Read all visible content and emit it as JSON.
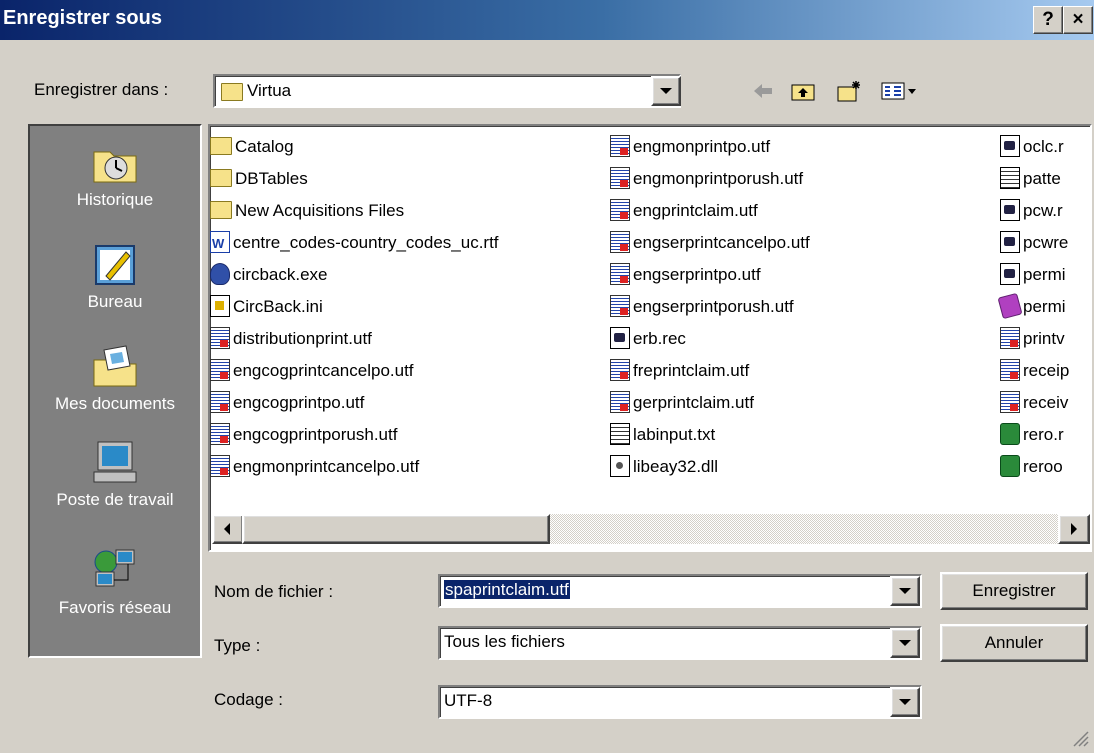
{
  "window": {
    "title": "Enregistrer sous",
    "help_label": "?",
    "close_label": "×"
  },
  "location": {
    "label": "Enregistrer dans :",
    "value": "Virtua"
  },
  "places": [
    {
      "label": "Historique",
      "icon": "history-icon"
    },
    {
      "label": "Bureau",
      "icon": "desktop-icon"
    },
    {
      "label": "Mes documents",
      "icon": "my-documents-icon"
    },
    {
      "label": "Poste de travail",
      "icon": "my-computer-icon"
    },
    {
      "label": "Favoris réseau",
      "icon": "network-icon"
    }
  ],
  "files": {
    "col1": [
      {
        "name": "Catalog",
        "type": "folder"
      },
      {
        "name": "DBTables",
        "type": "folder"
      },
      {
        "name": "New Acquisitions Files",
        "type": "folder"
      },
      {
        "name": "centre_codes-country_codes_uc.rtf",
        "type": "rtf"
      },
      {
        "name": "circback.exe",
        "type": "exe"
      },
      {
        "name": "CircBack.ini",
        "type": "ini"
      },
      {
        "name": "distributionprint.utf",
        "type": "utf"
      },
      {
        "name": "engcogprintcancelpo.utf",
        "type": "utf"
      },
      {
        "name": "engcogprintpo.utf",
        "type": "utf"
      },
      {
        "name": "engcogprintporush.utf",
        "type": "utf"
      },
      {
        "name": "engmonprintcancelpo.utf",
        "type": "utf"
      }
    ],
    "col2": [
      {
        "name": "engmonprintpo.utf",
        "type": "utf"
      },
      {
        "name": "engmonprintporush.utf",
        "type": "utf"
      },
      {
        "name": "engprintclaim.utf",
        "type": "utf"
      },
      {
        "name": "engserprintcancelpo.utf",
        "type": "utf"
      },
      {
        "name": "engserprintpo.utf",
        "type": "utf"
      },
      {
        "name": "engserprintporush.utf",
        "type": "utf"
      },
      {
        "name": "erb.rec",
        "type": "rec"
      },
      {
        "name": "freprintclaim.utf",
        "type": "utf"
      },
      {
        "name": "gerprintclaim.utf",
        "type": "utf"
      },
      {
        "name": "labinput.txt",
        "type": "txt"
      },
      {
        "name": "libeay32.dll",
        "type": "dll"
      }
    ],
    "col3": [
      {
        "name": "oclc.r",
        "type": "rec"
      },
      {
        "name": "patte",
        "type": "txt"
      },
      {
        "name": "pcw.r",
        "type": "rec"
      },
      {
        "name": "pcwre",
        "type": "rec"
      },
      {
        "name": "permi",
        "type": "rec"
      },
      {
        "name": "permi",
        "type": "book"
      },
      {
        "name": "printv",
        "type": "utf"
      },
      {
        "name": "receip",
        "type": "utf"
      },
      {
        "name": "receiv",
        "type": "utf"
      },
      {
        "name": "rero.r",
        "type": "glob"
      },
      {
        "name": "reroo",
        "type": "glob"
      }
    ]
  },
  "form": {
    "filename_label": "Nom de fichier :",
    "filename_value": "spaprintclaim.utf",
    "type_label": "Type :",
    "type_value": "Tous les fichiers",
    "encoding_label": "Codage :",
    "encoding_value": "UTF-8"
  },
  "buttons": {
    "save": "Enregistrer",
    "cancel": "Annuler"
  }
}
